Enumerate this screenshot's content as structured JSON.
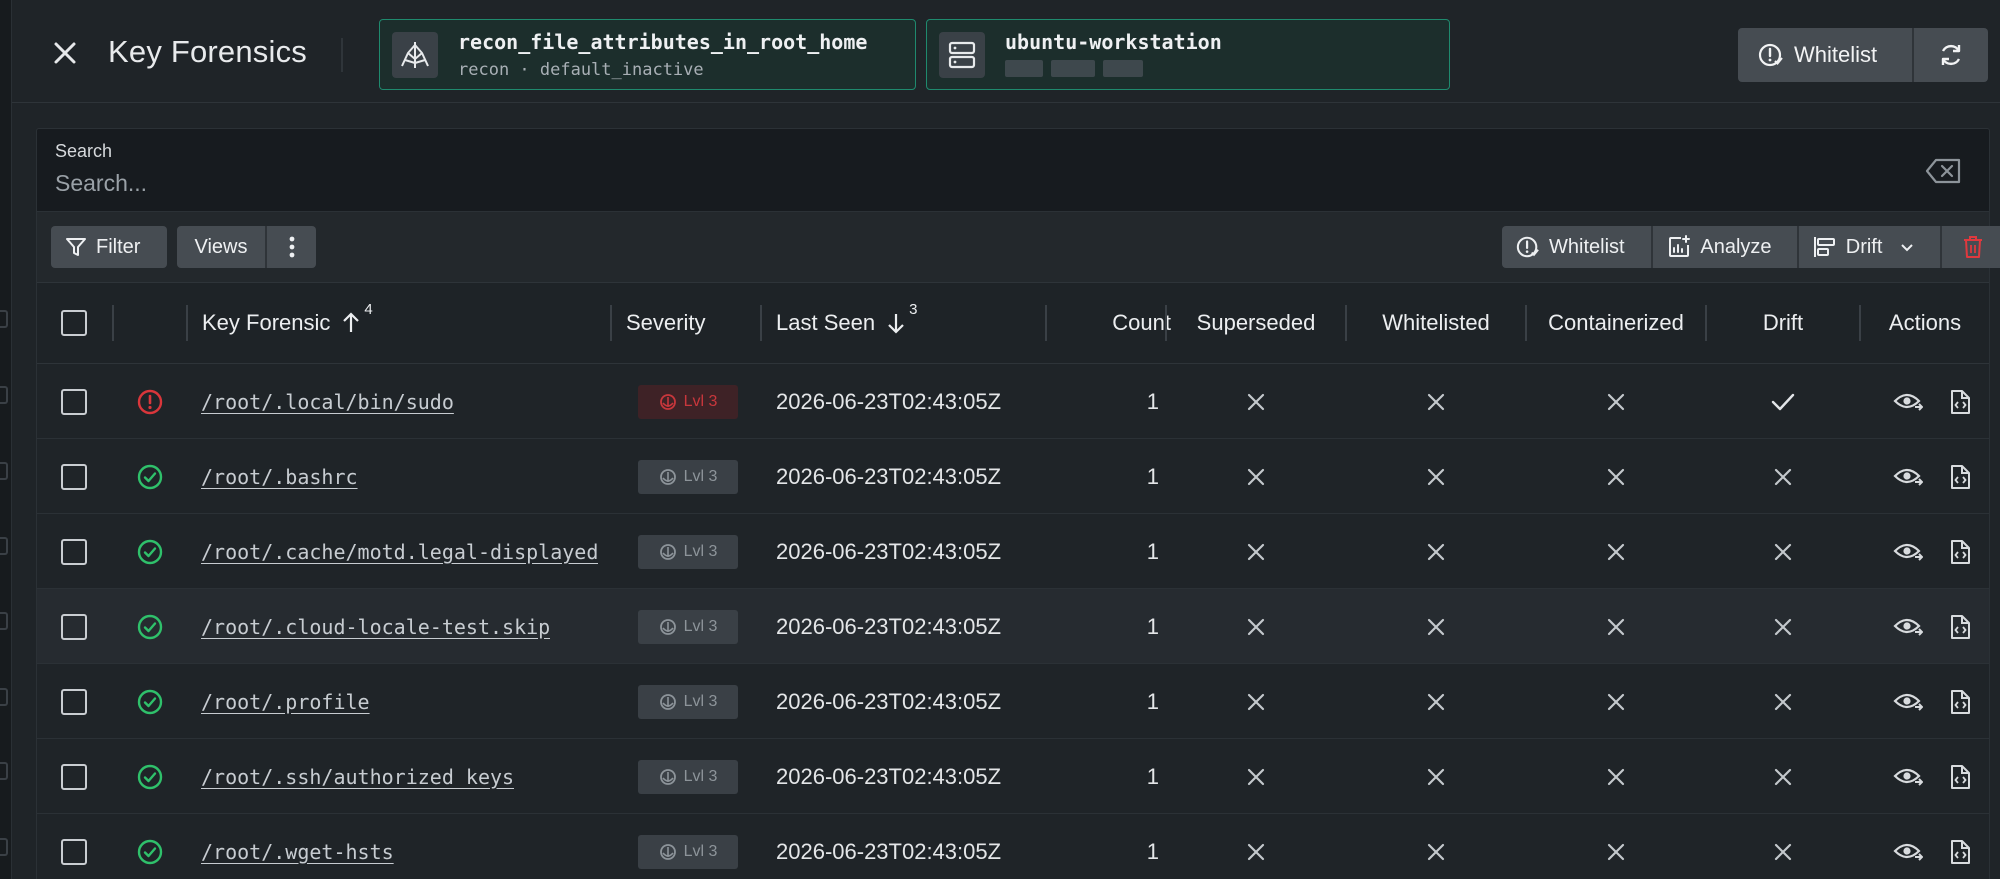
{
  "header": {
    "title": "Key Forensics",
    "chip_rule": {
      "name": "recon_file_attributes_in_root_home",
      "sub": "recon · default_inactive"
    },
    "chip_host": {
      "name": "ubuntu-workstation"
    },
    "whitelist_label": "Whitelist"
  },
  "search": {
    "label": "Search",
    "placeholder": "Search..."
  },
  "toolbar": {
    "filter_label": "Filter",
    "views_label": "Views",
    "whitelist_label": "Whitelist",
    "analyze_label": "Analyze",
    "drift_label": "Drift"
  },
  "table": {
    "columns": {
      "key_forensic": "Key Forensic",
      "key_forensic_sort": "4",
      "severity": "Severity",
      "last_seen": "Last Seen",
      "last_seen_sort": "3",
      "count": "Count",
      "superseded": "Superseded",
      "whitelisted": "Whitelisted",
      "containerized": "Containerized",
      "drift": "Drift",
      "actions": "Actions"
    },
    "rows": [
      {
        "status": "alert",
        "path": "/root/.local/bin/sudo",
        "severity": "Lvl 3",
        "sev_color": "#c8373c",
        "last_seen": "2026-06-23T02:43:05Z",
        "count": "1",
        "superseded": false,
        "whitelisted": false,
        "containerized": false,
        "drift": true
      },
      {
        "status": "ok",
        "path": "/root/.bashrc",
        "severity": "Lvl 3",
        "sev_color": "#8d949a",
        "last_seen": "2026-06-23T02:43:05Z",
        "count": "1",
        "superseded": false,
        "whitelisted": false,
        "containerized": false,
        "drift": false
      },
      {
        "status": "ok",
        "path": "/root/.cache/motd.legal-displayed",
        "severity": "Lvl 3",
        "sev_color": "#8d949a",
        "last_seen": "2026-06-23T02:43:05Z",
        "count": "1",
        "superseded": false,
        "whitelisted": false,
        "containerized": false,
        "drift": false
      },
      {
        "status": "ok",
        "path": "/root/.cloud-locale-test.skip",
        "severity": "Lvl 3",
        "sev_color": "#8d949a",
        "last_seen": "2026-06-23T02:43:05Z",
        "count": "1",
        "superseded": false,
        "whitelisted": false,
        "containerized": false,
        "drift": false
      },
      {
        "status": "ok",
        "path": "/root/.profile",
        "severity": "Lvl 3",
        "sev_color": "#8d949a",
        "last_seen": "2026-06-23T02:43:05Z",
        "count": "1",
        "superseded": false,
        "whitelisted": false,
        "containerized": false,
        "drift": false
      },
      {
        "status": "ok",
        "path": "/root/.ssh/authorized_keys",
        "severity": "Lvl 3",
        "sev_color": "#8d949a",
        "last_seen": "2026-06-23T02:43:05Z",
        "count": "1",
        "superseded": false,
        "whitelisted": false,
        "containerized": false,
        "drift": false
      },
      {
        "status": "ok",
        "path": "/root/.wget-hsts",
        "severity": "Lvl 3",
        "sev_color": "#8d949a",
        "last_seen": "2026-06-23T02:43:05Z",
        "count": "1",
        "superseded": false,
        "whitelisted": false,
        "containerized": false,
        "drift": false
      }
    ]
  },
  "colors": {
    "accent_teal": "#1f8a6e",
    "ok_green": "#2fc16b",
    "alert_red": "#d9363b"
  }
}
